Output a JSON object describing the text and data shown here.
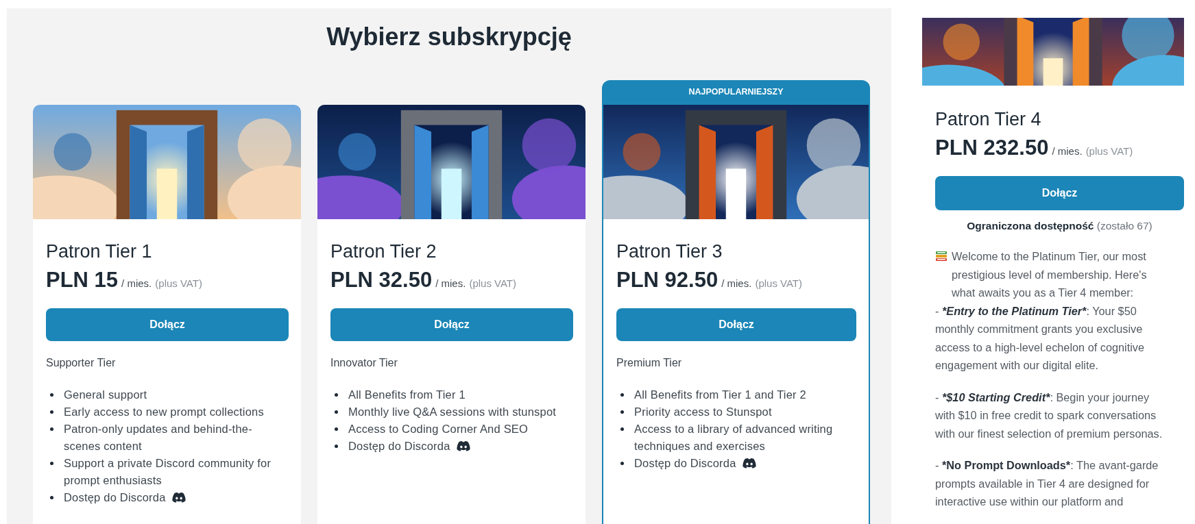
{
  "heading": "Wybierz subskrypcję",
  "plans": [
    {
      "name": "Patron Tier 1",
      "price": "PLN 15",
      "period": "/ mies.",
      "tax_note": "(plus VAT)",
      "button": "Dołącz",
      "subtitle": "Supporter Tier",
      "features": [
        {
          "kind": "text",
          "text": "General support"
        },
        {
          "kind": "text",
          "text": "Early access to new prompt collections"
        },
        {
          "kind": "text",
          "text": "Patron-only updates and behind-the-scenes content"
        },
        {
          "kind": "text",
          "text": "Support a private Discord community for prompt enthusiasts"
        },
        {
          "kind": "discord",
          "text": "Dostęp do Discorda"
        }
      ]
    },
    {
      "name": "Patron Tier 2",
      "price": "PLN 32.50",
      "period": "/ mies.",
      "tax_note": "(plus VAT)",
      "button": "Dołącz",
      "subtitle": "Innovator Tier",
      "features": [
        {
          "kind": "text",
          "text": "All Benefits from Tier 1"
        },
        {
          "kind": "text",
          "text": "Monthly live Q&A sessions with stunspot"
        },
        {
          "kind": "text",
          "text": "Access to Coding Corner And SEO"
        },
        {
          "kind": "discord",
          "text": "Dostęp do Discorda"
        }
      ]
    },
    {
      "badge": "NAJPOPULARNIEJSZY",
      "name": "Patron Tier 3",
      "price": "PLN 92.50",
      "period": "/ mies.",
      "tax_note": "(plus VAT)",
      "button": "Dołącz",
      "subtitle": "Premium Tier",
      "features": [
        {
          "kind": "text",
          "text": "All Benefits from Tier 1 and Tier 2"
        },
        {
          "kind": "text",
          "text": "Priority access to Stunspot"
        },
        {
          "kind": "text",
          "text": "Access to a library of advanced writing techniques and exercises"
        },
        {
          "kind": "discord",
          "text": "Dostęp do Discorda"
        }
      ]
    }
  ],
  "featured_plan": {
    "name": "Patron Tier 4",
    "price": "PLN 232.50",
    "period": "/ mies.",
    "tax_note": "(plus VAT)",
    "button": "Dołącz",
    "availability": "**Ograniczona dostępność** (zostało 67)",
    "description": [
      {
        "lines": [
          {
            "kind": "books",
            "segments": [
              {
                "kind": "plain",
                "text": "Welcome to the Platinum Tier, our most prestigious level of membership. Here's what awaits you as a Tier 4 member:"
              }
            ]
          },
          {
            "kind": "text",
            "segments": [
              {
                "kind": "plain",
                "text": "- "
              },
              {
                "kind": "bold-italic",
                "text": "*Entry to the Platinum Tier*"
              },
              {
                "kind": "plain",
                "text": ": Your $50 monthly commitment grants you exclusive access to a high-level echelon of cognitive engagement with our digital elite."
              }
            ]
          }
        ]
      },
      {
        "lines": [
          {
            "kind": "text",
            "segments": [
              {
                "kind": "plain",
                "text": "- "
              },
              {
                "kind": "bold-italic",
                "text": "*$10 Starting Credit*"
              },
              {
                "kind": "plain",
                "text": ": Begin your journey with $10 in free credit to spark conversations with our finest selection of premium personas."
              }
            ]
          }
        ]
      },
      {
        "lines": [
          {
            "kind": "text",
            "segments": [
              {
                "kind": "plain",
                "text": "- "
              },
              {
                "kind": "bold",
                "text": "*No Prompt Downloads*"
              },
              {
                "kind": "plain",
                "text": ": The avant-garde prompts available in Tier 4 are designed for interactive use within our platform and"
              }
            ]
          }
        ]
      }
    ]
  }
}
